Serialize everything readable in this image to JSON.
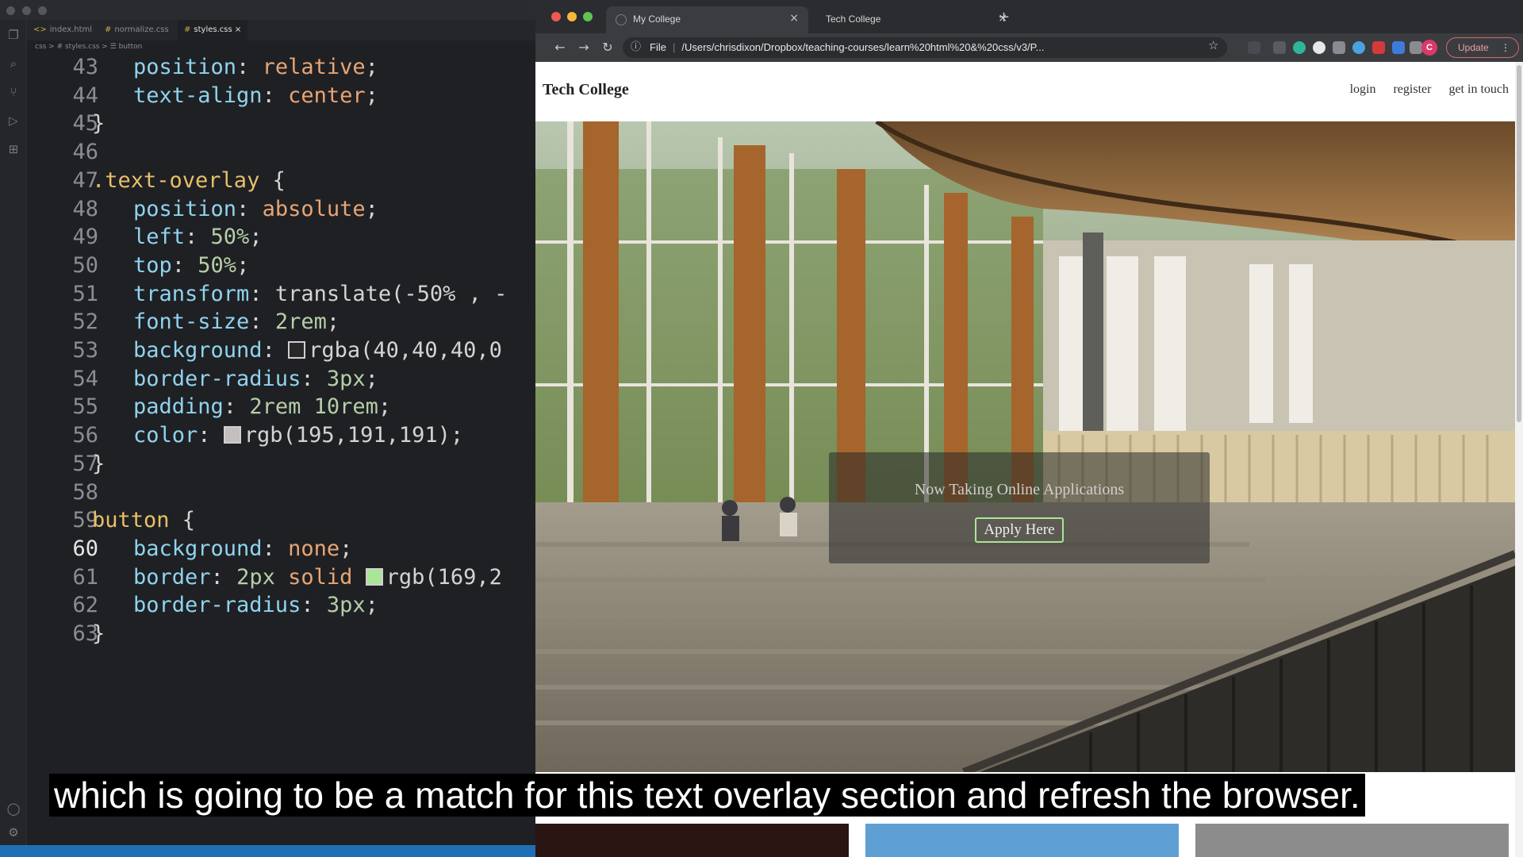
{
  "editor": {
    "tabs": [
      {
        "label": "index.html",
        "marker": "<>"
      },
      {
        "label": "normalize.css",
        "marker": "#"
      },
      {
        "label": "styles.css",
        "marker": "#"
      }
    ],
    "breadcrumb": "css > # styles.css > ☰ button",
    "lines": [
      {
        "n": "43",
        "parts": [
          [
            "prop",
            "position"
          ],
          [
            "pun",
            ": "
          ],
          [
            "val",
            "relative"
          ],
          [
            "pun",
            ";"
          ]
        ]
      },
      {
        "n": "44",
        "parts": [
          [
            "prop",
            "text-align"
          ],
          [
            "pun",
            ": "
          ],
          [
            "val",
            "center"
          ],
          [
            "pun",
            ";"
          ]
        ]
      },
      {
        "n": "45",
        "parts": [
          [
            "pun",
            "}"
          ]
        ],
        "indent": 0
      },
      {
        "n": "46",
        "parts": [],
        "indent": 0
      },
      {
        "n": "47",
        "parts": [
          [
            "sel",
            ".text-overlay"
          ],
          [
            "pun",
            " {"
          ]
        ],
        "indent": 0
      },
      {
        "n": "48",
        "parts": [
          [
            "prop",
            "position"
          ],
          [
            "pun",
            ": "
          ],
          [
            "val",
            "absolute"
          ],
          [
            "pun",
            ";"
          ]
        ]
      },
      {
        "n": "49",
        "parts": [
          [
            "prop",
            "left"
          ],
          [
            "pun",
            ": "
          ],
          [
            "num",
            "50%"
          ],
          [
            "pun",
            ";"
          ]
        ]
      },
      {
        "n": "50",
        "parts": [
          [
            "prop",
            "top"
          ],
          [
            "pun",
            ": "
          ],
          [
            "num",
            "50%"
          ],
          [
            "pun",
            ";"
          ]
        ]
      },
      {
        "n": "51",
        "parts": [
          [
            "prop",
            "transform"
          ],
          [
            "pun",
            ": "
          ],
          [
            "pun",
            "translate(-50% , -"
          ]
        ]
      },
      {
        "n": "52",
        "parts": [
          [
            "prop",
            "font-size"
          ],
          [
            "pun",
            ": "
          ],
          [
            "num",
            "2rem"
          ],
          [
            "pun",
            ";"
          ]
        ]
      },
      {
        "n": "53",
        "parts": [
          [
            "prop",
            "background"
          ],
          [
            "pun",
            ": "
          ],
          [
            "swatch",
            "#282828"
          ],
          [
            "pun",
            "rgba(40,40,40,0"
          ]
        ]
      },
      {
        "n": "54",
        "parts": [
          [
            "prop",
            "border-radius"
          ],
          [
            "pun",
            ": "
          ],
          [
            "num",
            "3px"
          ],
          [
            "pun",
            ";"
          ]
        ]
      },
      {
        "n": "55",
        "parts": [
          [
            "prop",
            "padding"
          ],
          [
            "pun",
            ": "
          ],
          [
            "num",
            "2rem 10rem"
          ],
          [
            "pun",
            ";"
          ]
        ]
      },
      {
        "n": "56",
        "parts": [
          [
            "prop",
            "color"
          ],
          [
            "pun",
            ": "
          ],
          [
            "swatch",
            "#c3bfbf"
          ],
          [
            "pun",
            "rgb(195,191,191);"
          ]
        ]
      },
      {
        "n": "57",
        "parts": [
          [
            "pun",
            "}"
          ]
        ],
        "indent": 0
      },
      {
        "n": "58",
        "parts": [],
        "indent": 0
      },
      {
        "n": "59",
        "parts": [
          [
            "sel",
            "button"
          ],
          [
            "pun",
            " {"
          ]
        ],
        "indent": 0
      },
      {
        "n": "60",
        "parts": [
          [
            "prop",
            "background"
          ],
          [
            "pun",
            ": "
          ],
          [
            "val",
            "none"
          ],
          [
            "pun",
            ";"
          ]
        ],
        "current": true
      },
      {
        "n": "61",
        "parts": [
          [
            "prop",
            "border"
          ],
          [
            "pun",
            ": "
          ],
          [
            "num",
            "2px"
          ],
          [
            "val",
            " solid "
          ],
          [
            "swatch",
            "#a9e696"
          ],
          [
            "pun",
            "rgb(169,2"
          ]
        ]
      },
      {
        "n": "62",
        "parts": [
          [
            "prop",
            "border-radius"
          ],
          [
            "pun",
            ": "
          ],
          [
            "num",
            "3px"
          ],
          [
            "pun",
            ";"
          ]
        ]
      },
      {
        "n": "63",
        "parts": [
          [
            "pun",
            "}"
          ]
        ],
        "indent": 0
      }
    ]
  },
  "browser": {
    "tabs": [
      {
        "title": "My College",
        "active": true
      },
      {
        "title": "Tech College",
        "active": false
      }
    ],
    "address_scheme": "File",
    "address_url": "/Users/chrisdixon/Dropbox/teaching-courses/learn%20html%20&%20css/v3/P...",
    "profile_initial": "C",
    "update_label": "Update"
  },
  "site": {
    "logo": "Tech College",
    "nav": [
      "login",
      "register",
      "get in touch"
    ],
    "overlay_heading": "Now Taking Online Applications",
    "apply_button": "Apply Here"
  },
  "caption": "which is going to be a match for this text overlay section and refresh the browser.",
  "colors": {
    "editor_bg": "#1f2023",
    "prop": "#8fd3ef",
    "value": "#e8a574",
    "selector": "#e8bf6a",
    "button_border": "#a9e696",
    "update_border": "#d16969"
  }
}
